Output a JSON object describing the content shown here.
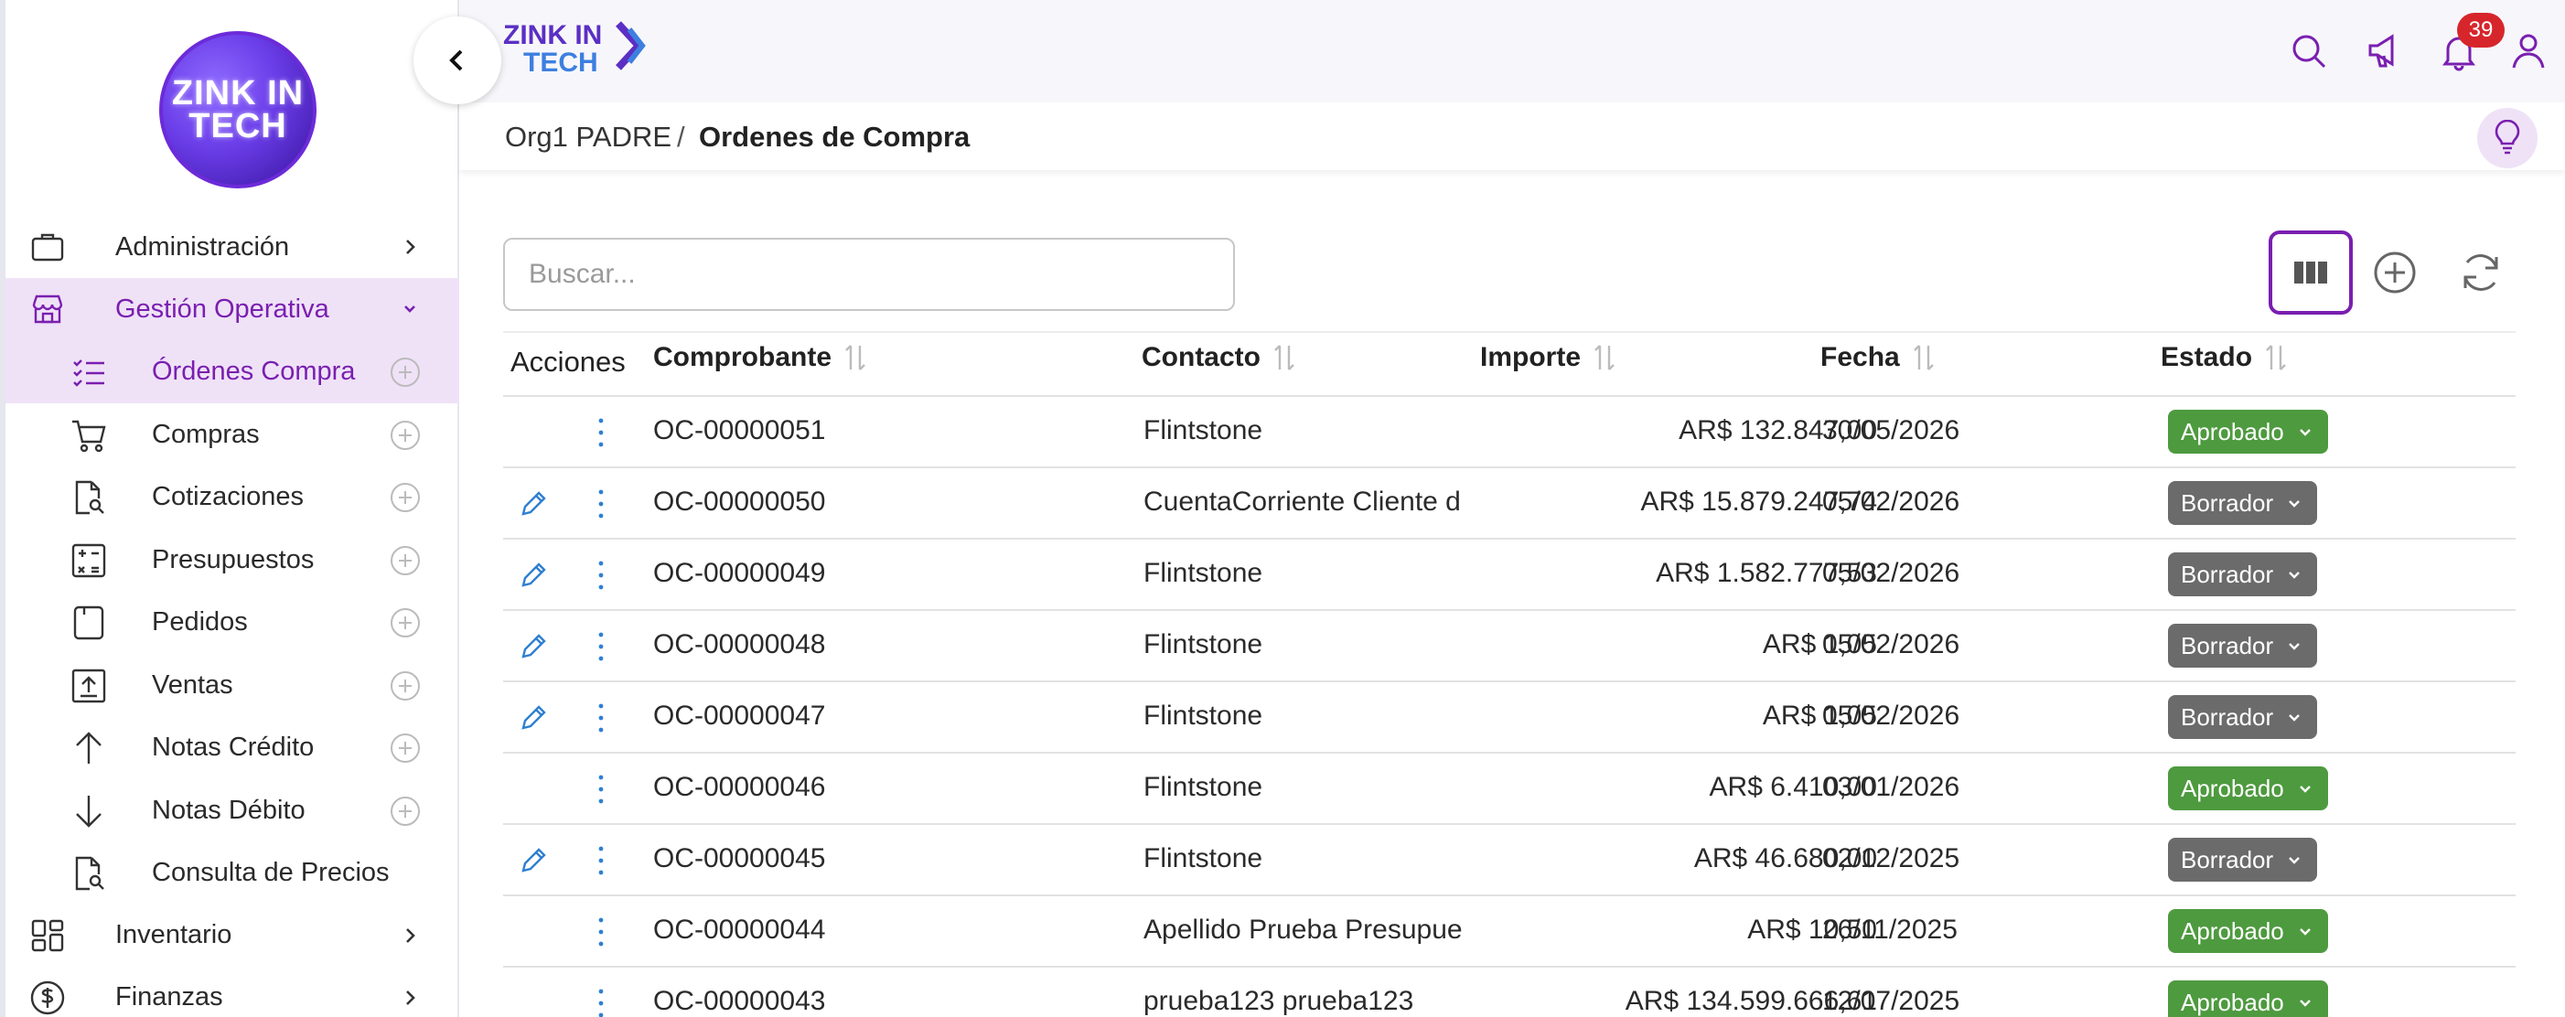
{
  "colors": {
    "accent": "#7a1fb0",
    "approved": "#4e9a3f",
    "draft": "#6b6b6b",
    "badge": "#d6262b",
    "edit": "#2f7fd1"
  },
  "logo": {
    "line1": "ZINK IN",
    "line2": "TECH"
  },
  "brand": {
    "line1": "ZINK IN",
    "line2": "TECH"
  },
  "header": {
    "notifications_count": "39"
  },
  "breadcrumb": {
    "parent": "Org1 PADRE",
    "separator": "/",
    "current": "Ordenes de Compra"
  },
  "sidebar": {
    "items": [
      {
        "label": "Administración",
        "icon": "briefcase-icon"
      },
      {
        "label": "Gestión Operativa",
        "icon": "store-icon",
        "expanded": true
      },
      {
        "label": "Inventario",
        "icon": "grid-icon"
      },
      {
        "label": "Finanzas",
        "icon": "dollar-icon"
      }
    ],
    "subitems": [
      {
        "label": "Órdenes Compra",
        "icon": "list-check-icon",
        "active": true
      },
      {
        "label": "Compras",
        "icon": "cart-icon"
      },
      {
        "label": "Cotizaciones",
        "icon": "doc-search-icon"
      },
      {
        "label": "Presupuestos",
        "icon": "calculator-icon"
      },
      {
        "label": "Pedidos",
        "icon": "order-icon"
      },
      {
        "label": "Ventas",
        "icon": "upload-box-icon"
      },
      {
        "label": "Notas Crédito",
        "icon": "arrow-up-icon"
      },
      {
        "label": "Notas Débito",
        "icon": "arrow-down-icon"
      },
      {
        "label": "Consulta de Precios",
        "icon": "doc-search-icon"
      }
    ]
  },
  "search": {
    "placeholder": "Buscar..."
  },
  "table": {
    "headers": {
      "actions": "Acciones",
      "comprobante": "Comprobante",
      "contacto": "Contacto",
      "importe": "Importe",
      "fecha": "Fecha",
      "estado": "Estado"
    },
    "rows": [
      {
        "comprobante": "OC-00000051",
        "contacto": "Flintstone",
        "importe": "AR$ 132.847,00",
        "fecha": "30/05/2026",
        "estado": "Aprobado",
        "editable": false
      },
      {
        "comprobante": "OC-00000050",
        "contacto": "CuentaCorriente Cliente d",
        "importe": "AR$ 15.879.247,74",
        "fecha": "05/02/2026",
        "estado": "Borrador",
        "editable": true
      },
      {
        "comprobante": "OC-00000049",
        "contacto": "Flintstone",
        "importe": "AR$ 1.582.777,53",
        "fecha": "05/02/2026",
        "estado": "Borrador",
        "editable": true
      },
      {
        "comprobante": "OC-00000048",
        "contacto": "Flintstone",
        "importe": "AR$ 1,05",
        "fecha": "05/02/2026",
        "estado": "Borrador",
        "editable": true
      },
      {
        "comprobante": "OC-00000047",
        "contacto": "Flintstone",
        "importe": "AR$ 1,05",
        "fecha": "05/02/2026",
        "estado": "Borrador",
        "editable": true
      },
      {
        "comprobante": "OC-00000046",
        "contacto": "Flintstone",
        "importe": "AR$ 6.410,00",
        "fecha": "03/01/2026",
        "estado": "Aprobado",
        "editable": false
      },
      {
        "comprobante": "OC-00000045",
        "contacto": "Flintstone",
        "importe": "AR$ 46.680,00",
        "fecha": "02/12/2025",
        "estado": "Borrador",
        "editable": true
      },
      {
        "comprobante": "OC-00000044",
        "contacto": "Apellido Prueba Presupue",
        "importe": "AR$ 10,50",
        "fecha": "26/11/2025",
        "estado": "Aprobado",
        "editable": false
      },
      {
        "comprobante": "OC-00000043",
        "contacto": "prueba123 prueba123",
        "importe": "AR$ 134.599.666,61",
        "fecha": "12/07/2025",
        "estado": "Aprobado",
        "editable": false
      }
    ]
  }
}
